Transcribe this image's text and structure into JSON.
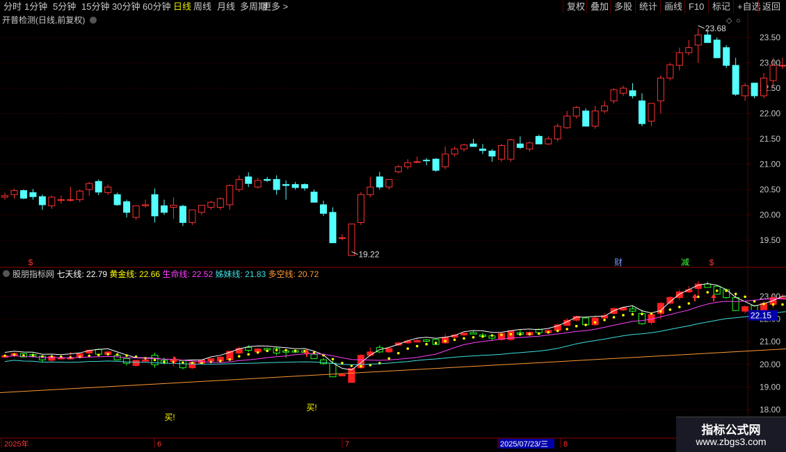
{
  "toolbar": {
    "periods": [
      "分时",
      "1分钟",
      "5分钟",
      "15分钟",
      "30分钟",
      "60分钟",
      "日线",
      "周线",
      "月线",
      "多周期",
      "更多"
    ],
    "active_period": "日线",
    "actions": [
      "复权",
      "叠加",
      "多股",
      "统计",
      "画线",
      "F10",
      "标记",
      "+自选",
      "返回"
    ]
  },
  "main_chart": {
    "title": "开普检测(日线,前复权)",
    "high_label": "23.68",
    "low_label": "19.22",
    "price_ticks": [
      "23.50",
      "23.00",
      "22.50",
      "22.00",
      "21.50",
      "21.00",
      "20.50",
      "20.00",
      "19.50"
    ],
    "markers": {
      "s1": "$",
      "cai": "财",
      "jian": "减",
      "s2": "$"
    }
  },
  "indicator": {
    "name": "股朋指标网",
    "items": [
      {
        "label": "七天线:",
        "value": "22.79",
        "color": "#ffffff"
      },
      {
        "label": "黄金线:",
        "value": "22.66",
        "color": "#ffff00"
      },
      {
        "label": "生命线:",
        "value": "22.52",
        "color": "#ff40ff"
      },
      {
        "label": "姊妹线:",
        "value": "21.83",
        "color": "#40e0e0"
      },
      {
        "label": "多空线:",
        "value": "20.72",
        "color": "#ff9933"
      }
    ],
    "ticks": [
      "23.00",
      "22.00",
      "21.00",
      "20.00",
      "19.00",
      "18.00"
    ],
    "current_price": "22.15",
    "buy_label": "买!"
  },
  "date_axis": {
    "labels": [
      "2025年",
      "6",
      "7",
      "2025/07/23/三",
      "8"
    ]
  },
  "watermark": {
    "title": "指标公式网",
    "url": "www.zbgs3.com"
  },
  "colors": {
    "up": "#ff3232",
    "down": "#54ffff",
    "grid": "#5a0000",
    "ind_up": "#ff2020",
    "ind_down": "#20ff20"
  },
  "chart_data": {
    "type": "candlestick",
    "ylim": [
      19.0,
      23.85
    ],
    "candles": [
      [
        20.35,
        20.44,
        20.3,
        20.38
      ],
      [
        20.4,
        20.52,
        20.32,
        20.48
      ],
      [
        20.48,
        20.5,
        20.31,
        20.33
      ],
      [
        20.44,
        20.51,
        20.3,
        20.36
      ],
      [
        20.36,
        20.4,
        20.1,
        20.2
      ],
      [
        20.18,
        20.38,
        20.12,
        20.35
      ],
      [
        20.3,
        20.38,
        20.22,
        20.3
      ],
      [
        20.3,
        20.55,
        20.26,
        20.3
      ],
      [
        20.3,
        20.5,
        20.25,
        20.47
      ],
      [
        20.5,
        20.65,
        20.38,
        20.62
      ],
      [
        20.66,
        20.7,
        20.39,
        20.45
      ],
      [
        20.44,
        20.6,
        20.4,
        20.55
      ],
      [
        20.4,
        20.44,
        20.18,
        20.2
      ],
      [
        20.26,
        20.3,
        19.95,
        20.05
      ],
      [
        19.95,
        20.15,
        19.9,
        20.18
      ],
      [
        20.18,
        20.3,
        20.14,
        20.2
      ],
      [
        20.4,
        20.52,
        19.85,
        19.98
      ],
      [
        20.18,
        20.3,
        20.0,
        20.05
      ],
      [
        20.15,
        20.35,
        19.92,
        20.19
      ],
      [
        20.17,
        20.2,
        19.78,
        19.85
      ],
      [
        19.85,
        20.0,
        19.8,
        20.1
      ],
      [
        20.05,
        20.2,
        20.0,
        20.19
      ],
      [
        20.15,
        20.28,
        20.1,
        20.25
      ],
      [
        20.15,
        20.35,
        20.1,
        20.32
      ],
      [
        20.2,
        20.6,
        20.1,
        20.58
      ],
      [
        20.5,
        20.78,
        20.45,
        20.7
      ],
      [
        20.75,
        20.84,
        20.55,
        20.62
      ],
      [
        20.55,
        20.73,
        20.52,
        20.68
      ],
      [
        20.7,
        20.75,
        20.65,
        20.68
      ],
      [
        20.7,
        20.78,
        20.4,
        20.5
      ],
      [
        20.6,
        20.68,
        20.3,
        20.58
      ],
      [
        20.6,
        20.65,
        20.5,
        20.54
      ],
      [
        20.6,
        20.62,
        20.48,
        20.53
      ],
      [
        20.45,
        20.5,
        20.28,
        20.25
      ],
      [
        20.2,
        20.28,
        19.98,
        20.03
      ],
      [
        20.05,
        20.15,
        19.45,
        19.45
      ],
      [
        19.55,
        19.62,
        19.5,
        19.55
      ],
      [
        19.2,
        19.22,
        19.22,
        19.82
      ],
      [
        19.85,
        20.45,
        19.8,
        20.4
      ],
      [
        20.4,
        20.75,
        20.35,
        20.55
      ],
      [
        20.75,
        20.85,
        20.5,
        20.55
      ],
      [
        20.55,
        20.7,
        20.5,
        20.7
      ],
      [
        20.85,
        20.98,
        20.82,
        20.95
      ],
      [
        20.95,
        21.1,
        20.9,
        21.03
      ],
      [
        21.05,
        21.15,
        21.02,
        21.05
      ],
      [
        21.08,
        21.12,
        20.98,
        21.07
      ],
      [
        21.1,
        21.12,
        20.85,
        20.88
      ],
      [
        20.95,
        21.35,
        20.9,
        21.2
      ],
      [
        21.2,
        21.35,
        21.15,
        21.3
      ],
      [
        21.3,
        21.4,
        21.25,
        21.38
      ],
      [
        21.4,
        21.5,
        21.35,
        21.35
      ],
      [
        21.3,
        21.4,
        21.2,
        21.27
      ],
      [
        21.26,
        21.3,
        21.05,
        21.16
      ],
      [
        21.1,
        21.4,
        21.05,
        21.37
      ],
      [
        21.1,
        21.5,
        21.05,
        21.48
      ],
      [
        21.4,
        21.55,
        21.3,
        21.33
      ],
      [
        21.3,
        21.45,
        21.25,
        21.42
      ],
      [
        21.55,
        21.58,
        21.4,
        21.4
      ],
      [
        21.4,
        21.55,
        21.38,
        21.5
      ],
      [
        21.5,
        21.8,
        21.45,
        21.75
      ],
      [
        21.72,
        22.05,
        21.7,
        21.95
      ],
      [
        21.95,
        22.15,
        21.9,
        22.12
      ],
      [
        22.05,
        22.1,
        21.75,
        21.75
      ],
      [
        21.75,
        22.15,
        21.7,
        22.05
      ],
      [
        22.05,
        22.25,
        22.0,
        22.15
      ],
      [
        22.25,
        22.5,
        22.2,
        22.47
      ],
      [
        22.4,
        22.55,
        22.35,
        22.5
      ],
      [
        22.45,
        22.6,
        22.3,
        22.35
      ],
      [
        22.25,
        22.4,
        21.75,
        21.8
      ],
      [
        21.85,
        22.2,
        21.75,
        22.2
      ],
      [
        22.25,
        22.75,
        22.0,
        22.7
      ],
      [
        22.7,
        23.0,
        22.65,
        22.96
      ],
      [
        22.95,
        23.3,
        22.85,
        23.2
      ],
      [
        23.2,
        23.45,
        23.15,
        23.3
      ],
      [
        23.35,
        23.68,
        23.0,
        23.55
      ],
      [
        23.55,
        23.65,
        23.4,
        23.4
      ],
      [
        23.45,
        23.5,
        23.1,
        23.1
      ],
      [
        23.3,
        23.35,
        22.9,
        22.95
      ],
      [
        22.95,
        23.1,
        22.35,
        22.38
      ],
      [
        22.35,
        22.6,
        22.25,
        22.55
      ],
      [
        22.6,
        22.6,
        22.3,
        22.35
      ],
      [
        22.35,
        22.8,
        22.3,
        22.7
      ],
      [
        22.65,
        23.1,
        22.5,
        22.95
      ],
      [
        22.95,
        23.1,
        22.88,
        22.95
      ],
      [
        22.9,
        22.95,
        22.42,
        22.65
      ],
      [
        22.95,
        22.95,
        22.95,
        22.95
      ]
    ],
    "indicator_lines": {
      "七天线": 22.79,
      "黄金线": 22.66,
      "生命线": 22.52,
      "姊妹线": 21.83,
      "多空线": 20.72
    }
  }
}
